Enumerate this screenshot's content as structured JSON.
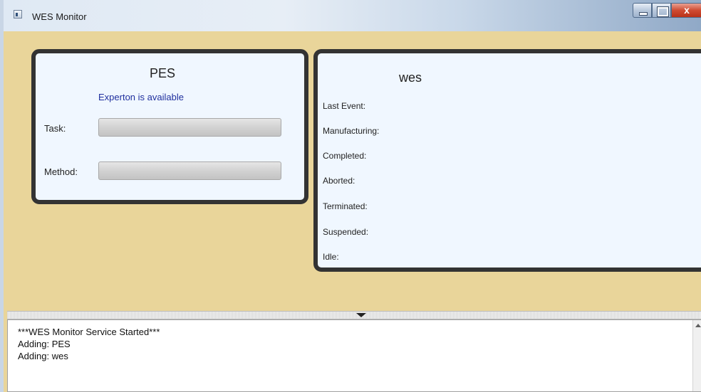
{
  "window": {
    "title": "WES Monitor",
    "close_glyph": "x"
  },
  "pes": {
    "title": "PES",
    "status": "Experton is available",
    "task_label": "Task:",
    "method_label": "Method:"
  },
  "wes": {
    "title": "wes",
    "labels": [
      "Last Event:",
      "Manufacturing:",
      "Completed:",
      "Aborted:",
      "Terminated:",
      "Suspended:",
      "Idle:"
    ]
  },
  "log": {
    "lines": [
      "***WES Monitor Service Started***",
      "Adding: PES",
      "Adding: wes"
    ]
  },
  "icons": {
    "app": "app-window-icon",
    "splitter_grip": "triangle-down-icon",
    "scroll_up": "scroll-up-arrow-icon"
  },
  "colors": {
    "window_background": "#e9d59a",
    "panel_background": "#f0f7ff",
    "panel_border": "#333333",
    "status_text": "#1f2f9e"
  }
}
